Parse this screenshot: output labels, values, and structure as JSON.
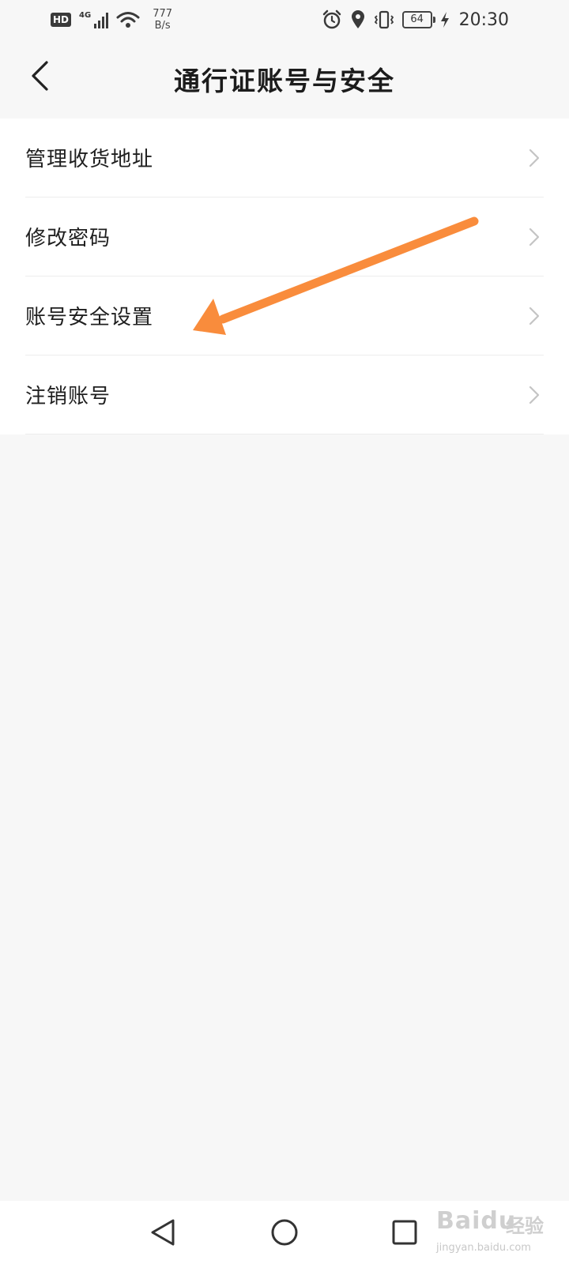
{
  "status_bar": {
    "hd": "HD",
    "network": "4G",
    "speed_value": "777",
    "speed_unit": "B/s",
    "battery": "64",
    "time": "20:30"
  },
  "header": {
    "title": "通行证账号与安全"
  },
  "menu": {
    "items": [
      {
        "label": "管理收货地址"
      },
      {
        "label": "修改密码"
      },
      {
        "label": "账号安全设置"
      },
      {
        "label": "注销账号"
      }
    ]
  },
  "colors": {
    "arrow": "#f98c3c",
    "background": "#f7f7f7",
    "list_background": "#ffffff",
    "chevron": "#c4c4c4"
  },
  "watermark": {
    "logo": "Baidu",
    "cn": "经验",
    "url": "jingyan.baidu.com"
  }
}
